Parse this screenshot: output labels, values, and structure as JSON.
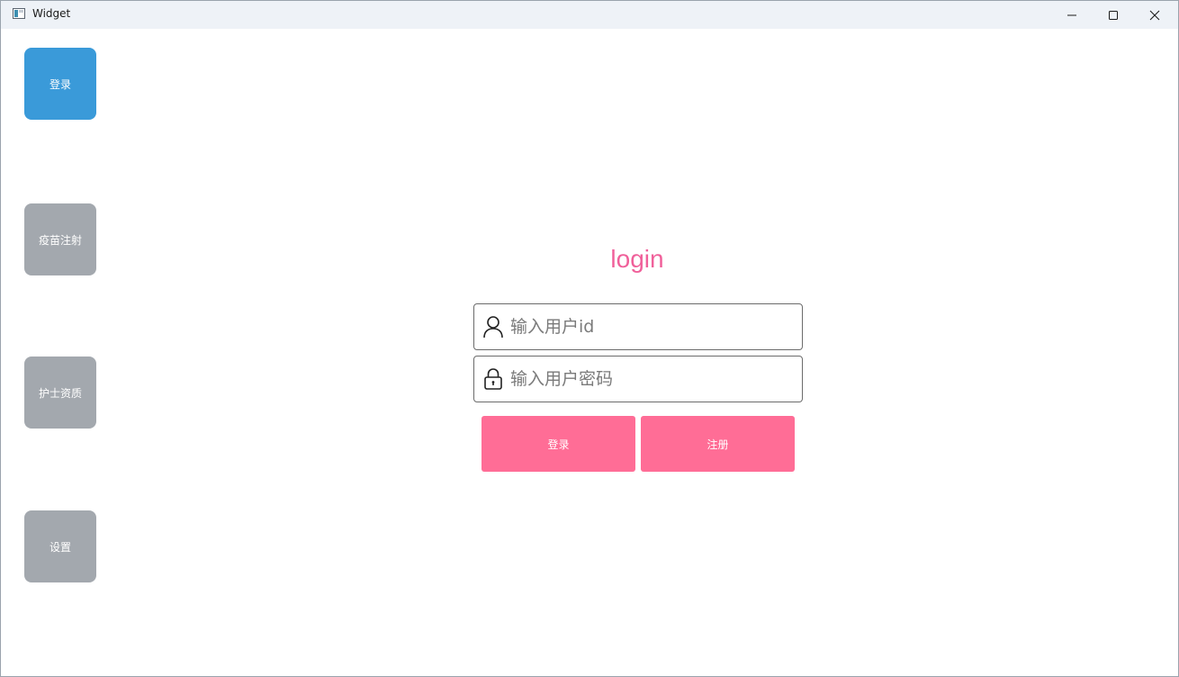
{
  "window": {
    "title": "Widget",
    "app_icon": "window-app-icon",
    "controls": [
      "minimize-icon",
      "maximize-icon",
      "close-icon"
    ]
  },
  "sidebar": {
    "items": [
      {
        "label": "登录",
        "active": true,
        "color": "#3a9ad9"
      },
      {
        "label": "疫苗注射",
        "active": false,
        "color": "#a3a8ae"
      },
      {
        "label": "护士资质",
        "active": false,
        "color": "#a3a8ae"
      },
      {
        "label": "设置",
        "active": false,
        "color": "#a3a8ae"
      }
    ]
  },
  "login": {
    "title": "login",
    "title_color": "#f0609a",
    "user_id": {
      "placeholder": "输入用户id",
      "value": "",
      "icon": "user-icon"
    },
    "password": {
      "placeholder": "输入用户密码",
      "value": "",
      "icon": "lock-icon"
    },
    "login_button": "登录",
    "register_button": "注册",
    "button_color": "#ff6d96"
  }
}
